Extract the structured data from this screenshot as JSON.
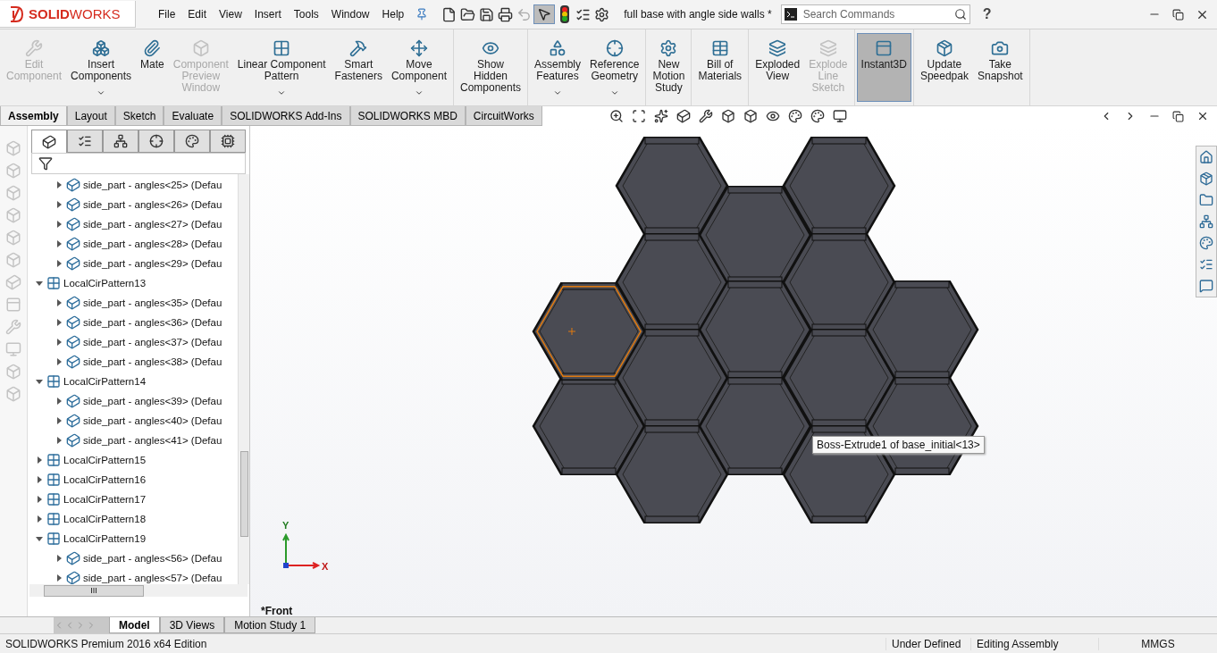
{
  "app": {
    "logo": "**SOLID**WORKS",
    "document_title": "full base with angle side walls *",
    "search": {
      "placeholder": "Search Commands"
    },
    "help": "?"
  },
  "menu": [
    "File",
    "Edit",
    "View",
    "Insert",
    "Tools",
    "Window",
    "Help"
  ],
  "command_groups": [
    {
      "commands": [
        {
          "label": "Edit\nComponent",
          "disabled": true,
          "selected": false,
          "dropdown": false
        },
        {
          "label": "Insert\nComponents",
          "disabled": false,
          "selected": false,
          "dropdown": true
        },
        {
          "label": "Mate",
          "disabled": false,
          "selected": false,
          "dropdown": false
        },
        {
          "label": "Component\nPreview\nWindow",
          "disabled": true,
          "selected": false,
          "dropdown": false
        },
        {
          "label": "Linear Component\nPattern",
          "disabled": false,
          "selected": false,
          "dropdown": true
        },
        {
          "label": "Smart\nFasteners",
          "disabled": false,
          "selected": false,
          "dropdown": false
        },
        {
          "label": "Move\nComponent",
          "disabled": false,
          "selected": false,
          "dropdown": true
        }
      ]
    },
    {
      "commands": [
        {
          "label": "Show\nHidden\nComponents",
          "disabled": false,
          "selected": false,
          "dropdown": false
        }
      ]
    },
    {
      "commands": [
        {
          "label": "Assembly\nFeatures",
          "disabled": false,
          "selected": false,
          "dropdown": true
        },
        {
          "label": "Reference\nGeometry",
          "disabled": false,
          "selected": false,
          "dropdown": true
        }
      ]
    },
    {
      "commands": [
        {
          "label": "New\nMotion\nStudy",
          "disabled": false,
          "selected": false,
          "dropdown": false
        }
      ]
    },
    {
      "commands": [
        {
          "label": "Bill of\nMaterials",
          "disabled": false,
          "selected": false,
          "dropdown": false
        }
      ]
    },
    {
      "commands": [
        {
          "label": "Exploded\nView",
          "disabled": false,
          "selected": false,
          "dropdown": false
        },
        {
          "label": "Explode\nLine\nSketch",
          "disabled": true,
          "selected": false,
          "dropdown": false
        }
      ]
    },
    {
      "commands": [
        {
          "label": "Instant3D",
          "disabled": false,
          "selected": true,
          "dropdown": false
        }
      ]
    },
    {
      "commands": [
        {
          "label": "Update\nSpeedpak",
          "disabled": false,
          "selected": false,
          "dropdown": false
        },
        {
          "label": "Take\nSnapshot",
          "disabled": false,
          "selected": false,
          "dropdown": false
        }
      ]
    }
  ],
  "tabs": [
    {
      "label": "Assembly",
      "selected": true
    },
    {
      "label": "Layout",
      "selected": false
    },
    {
      "label": "Sketch",
      "selected": false
    },
    {
      "label": "Evaluate",
      "selected": false
    },
    {
      "label": "SOLIDWORKS Add-Ins",
      "selected": false
    },
    {
      "label": "SOLIDWORKS MBD",
      "selected": false
    },
    {
      "label": "CircuitWorks",
      "selected": false
    }
  ],
  "feature_manager": {
    "tabs": [
      {
        "selected": true
      },
      {
        "selected": false
      },
      {
        "selected": false
      },
      {
        "selected": false
      },
      {
        "selected": false
      },
      {
        "selected": false
      }
    ],
    "tree": [
      {
        "children": [
          {
            "kind": "part",
            "label": "side_part - angles<25> (Defau",
            "expanded": false
          },
          {
            "kind": "part",
            "label": "side_part - angles<26> (Defau",
            "expanded": false
          },
          {
            "kind": "part",
            "label": "side_part - angles<27> (Defau",
            "expanded": false
          },
          {
            "kind": "part",
            "label": "side_part - angles<28> (Defau",
            "expanded": false
          },
          {
            "kind": "part",
            "label": "side_part - angles<29> (Defau",
            "expanded": false
          }
        ]
      },
      {
        "kind": "pattern",
        "label": "LocalCirPattern13",
        "expanded": true,
        "children": [
          {
            "kind": "part",
            "label": "side_part - angles<35> (Defau",
            "expanded": false
          },
          {
            "kind": "part",
            "label": "side_part - angles<36> (Defau",
            "expanded": false
          },
          {
            "kind": "part",
            "label": "side_part - angles<37> (Defau",
            "expanded": false
          },
          {
            "kind": "part",
            "label": "side_part - angles<38> (Defau",
            "expanded": false
          }
        ]
      },
      {
        "kind": "pattern",
        "label": "LocalCirPattern14",
        "expanded": true,
        "children": [
          {
            "kind": "part",
            "label": "side_part - angles<39> (Defau",
            "expanded": false
          },
          {
            "kind": "part",
            "label": "side_part - angles<40> (Defau",
            "expanded": false
          },
          {
            "kind": "part",
            "label": "side_part - angles<41> (Defau",
            "expanded": false
          }
        ]
      },
      {
        "kind": "pattern",
        "label": "LocalCirPattern15",
        "expanded": false
      },
      {
        "kind": "pattern",
        "label": "LocalCirPattern16",
        "expanded": false
      },
      {
        "kind": "pattern",
        "label": "LocalCirPattern17",
        "expanded": false
      },
      {
        "kind": "pattern",
        "label": "LocalCirPattern18",
        "expanded": false
      },
      {
        "kind": "pattern",
        "label": "LocalCirPattern19",
        "expanded": true,
        "children": [
          {
            "kind": "part",
            "label": "side_part - angles<56> (Defau",
            "expanded": false
          },
          {
            "kind": "part",
            "label": "side_part - angles<57> (Defau",
            "expanded": false
          }
        ]
      }
    ],
    "scroll_grip": "III"
  },
  "viewport": {
    "tooltip": "Boss-Extrude1 of base_initial<13>",
    "view_name": "*Front",
    "axis_y": "Y",
    "axis_x": "X"
  },
  "bottom_tabs": [
    {
      "label": "Model",
      "selected": true
    },
    {
      "label": "3D Views",
      "selected": false
    },
    {
      "label": "Motion Study 1",
      "selected": false
    }
  ],
  "status_bar": {
    "edition": "SOLIDWORKS Premium 2016 x64 Edition",
    "state": "Under Defined",
    "mode": "Editing Assembly",
    "units": "MMGS"
  }
}
